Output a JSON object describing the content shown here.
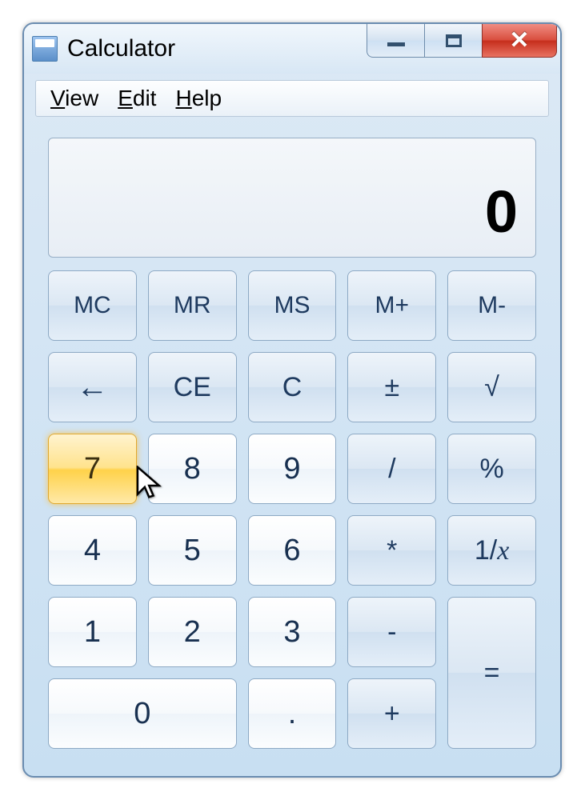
{
  "window": {
    "title": "Calculator"
  },
  "menu": {
    "view": "View",
    "edit": "Edit",
    "help": "Help"
  },
  "display": {
    "value": "0"
  },
  "buttons": {
    "mc": "MC",
    "mr": "MR",
    "ms": "MS",
    "mplus": "M+",
    "mminus": "M-",
    "back": "←",
    "ce": "CE",
    "c": "C",
    "pm": "±",
    "sqrt": "√",
    "n7": "7",
    "n8": "8",
    "n9": "9",
    "div": "/",
    "pct": "%",
    "n4": "4",
    "n5": "5",
    "n6": "6",
    "mul": "*",
    "recip": "1/x",
    "n1": "1",
    "n2": "2",
    "n3": "3",
    "sub": "-",
    "eq": "=",
    "n0": "0",
    "dot": ".",
    "add": "+"
  }
}
